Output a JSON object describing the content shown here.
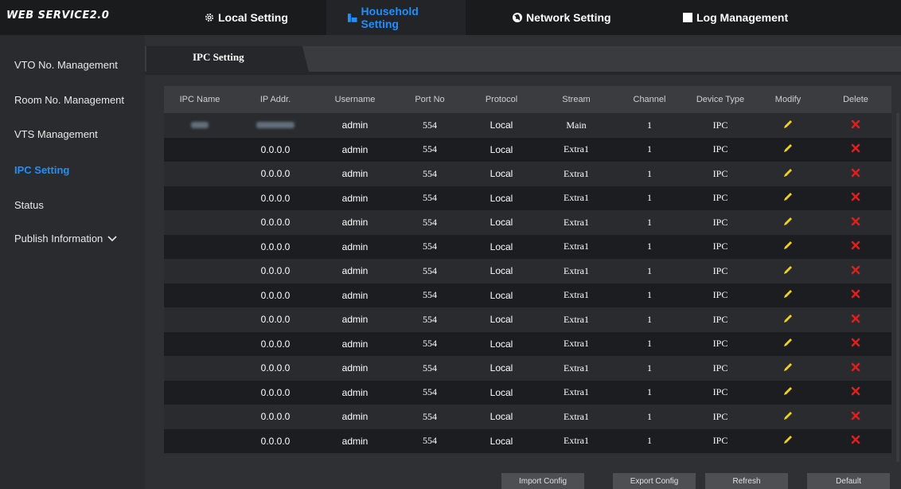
{
  "app": {
    "brand": "WEB SERVICE2.0"
  },
  "nav": [
    {
      "label": "Local Setting",
      "icon": "gear-icon"
    },
    {
      "label": "Household Setting",
      "icon": "building-icon"
    },
    {
      "label": "Network Setting",
      "icon": "globe-icon"
    },
    {
      "label": "Log Management",
      "icon": "log-icon"
    }
  ],
  "sidebar": {
    "items": [
      {
        "label": "VTO No. Management"
      },
      {
        "label": "Room No. Management"
      },
      {
        "label": "VTS Management"
      },
      {
        "label": "IPC Setting"
      },
      {
        "label": "Status"
      },
      {
        "label": "Publish Information"
      }
    ]
  },
  "tab": {
    "label": "IPC Setting"
  },
  "table": {
    "headers": [
      "IPC Name",
      "IP Addr.",
      "Username",
      "Port No",
      "Protocol",
      "Stream",
      "Channel",
      "Device Type",
      "Modify",
      "Delete"
    ],
    "rows": [
      {
        "ip": "",
        "username": "admin",
        "port": "554",
        "protocol": "Local",
        "stream": "Main",
        "channel": "1",
        "type": "IPC"
      },
      {
        "ip": "0.0.0.0",
        "username": "admin",
        "port": "554",
        "protocol": "Local",
        "stream": "Extra1",
        "channel": "1",
        "type": "IPC"
      },
      {
        "ip": "0.0.0.0",
        "username": "admin",
        "port": "554",
        "protocol": "Local",
        "stream": "Extra1",
        "channel": "1",
        "type": "IPC"
      },
      {
        "ip": "0.0.0.0",
        "username": "admin",
        "port": "554",
        "protocol": "Local",
        "stream": "Extra1",
        "channel": "1",
        "type": "IPC"
      },
      {
        "ip": "0.0.0.0",
        "username": "admin",
        "port": "554",
        "protocol": "Local",
        "stream": "Extra1",
        "channel": "1",
        "type": "IPC"
      },
      {
        "ip": "0.0.0.0",
        "username": "admin",
        "port": "554",
        "protocol": "Local",
        "stream": "Extra1",
        "channel": "1",
        "type": "IPC"
      },
      {
        "ip": "0.0.0.0",
        "username": "admin",
        "port": "554",
        "protocol": "Local",
        "stream": "Extra1",
        "channel": "1",
        "type": "IPC"
      },
      {
        "ip": "0.0.0.0",
        "username": "admin",
        "port": "554",
        "protocol": "Local",
        "stream": "Extra1",
        "channel": "1",
        "type": "IPC"
      },
      {
        "ip": "0.0.0.0",
        "username": "admin",
        "port": "554",
        "protocol": "Local",
        "stream": "Extra1",
        "channel": "1",
        "type": "IPC"
      },
      {
        "ip": "0.0.0.0",
        "username": "admin",
        "port": "554",
        "protocol": "Local",
        "stream": "Extra1",
        "channel": "1",
        "type": "IPC"
      },
      {
        "ip": "0.0.0.0",
        "username": "admin",
        "port": "554",
        "protocol": "Local",
        "stream": "Extra1",
        "channel": "1",
        "type": "IPC"
      },
      {
        "ip": "0.0.0.0",
        "username": "admin",
        "port": "554",
        "protocol": "Local",
        "stream": "Extra1",
        "channel": "1",
        "type": "IPC"
      },
      {
        "ip": "0.0.0.0",
        "username": "admin",
        "port": "554",
        "protocol": "Local",
        "stream": "Extra1",
        "channel": "1",
        "type": "IPC"
      },
      {
        "ip": "0.0.0.0",
        "username": "admin",
        "port": "554",
        "protocol": "Local",
        "stream": "Extra1",
        "channel": "1",
        "type": "IPC"
      }
    ]
  },
  "buttons": {
    "import": "Import Config",
    "export": "Export Config",
    "refresh": "Refresh",
    "default": "Default"
  },
  "colors": {
    "accent": "#1e90ff",
    "modify": "#f2d11b",
    "delete": "#e01e1e"
  }
}
